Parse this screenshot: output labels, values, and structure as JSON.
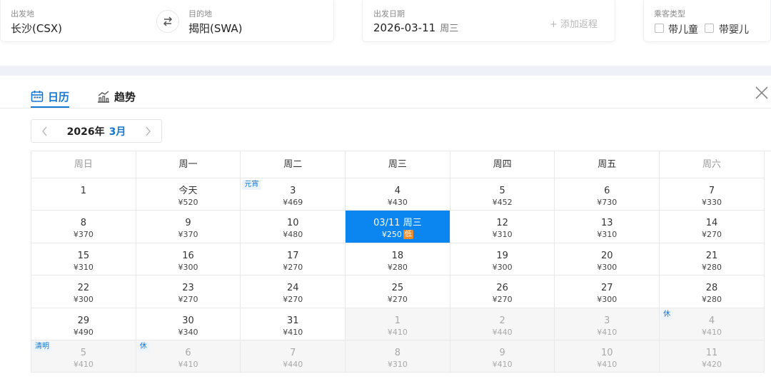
{
  "search": {
    "origin": {
      "label": "出发地",
      "value": "长沙(CSX)"
    },
    "destination": {
      "label": "目的地",
      "value": "揭阳(SWA)"
    },
    "depart": {
      "label": "出发日期",
      "date": "2026-03-11",
      "weekday": "周三"
    },
    "add_return": "+ 添加返程",
    "passengers": {
      "label": "乘客类型",
      "child": "带儿童",
      "infant": "带婴儿"
    }
  },
  "tabs": {
    "calendar": "日历",
    "trend": "趋势"
  },
  "month_nav": {
    "year": "2026年",
    "month": "3月"
  },
  "weekdays": [
    "周日",
    "周一",
    "周二",
    "周三",
    "周四",
    "周五",
    "周六"
  ],
  "weeks": [
    [
      {
        "day": "1",
        "price": ""
      },
      {
        "day": "今天",
        "price": "¥520"
      },
      {
        "day": "3",
        "price": "¥469",
        "tag": "元宵"
      },
      {
        "day": "4",
        "price": "¥430"
      },
      {
        "day": "5",
        "price": "¥452"
      },
      {
        "day": "6",
        "price": "¥730"
      },
      {
        "day": "7",
        "price": "¥330"
      }
    ],
    [
      {
        "day": "8",
        "price": "¥370"
      },
      {
        "day": "9",
        "price": "¥370"
      },
      {
        "day": "10",
        "price": "¥480"
      },
      {
        "day": "03/11 周三",
        "price": "¥250",
        "selected": true,
        "badge": "低"
      },
      {
        "day": "12",
        "price": "¥310"
      },
      {
        "day": "13",
        "price": "¥310"
      },
      {
        "day": "14",
        "price": "¥270"
      }
    ],
    [
      {
        "day": "15",
        "price": "¥310"
      },
      {
        "day": "16",
        "price": "¥300"
      },
      {
        "day": "17",
        "price": "¥270"
      },
      {
        "day": "18",
        "price": "¥280"
      },
      {
        "day": "19",
        "price": "¥300"
      },
      {
        "day": "20",
        "price": "¥300"
      },
      {
        "day": "21",
        "price": "¥280"
      }
    ],
    [
      {
        "day": "22",
        "price": "¥300"
      },
      {
        "day": "23",
        "price": "¥270"
      },
      {
        "day": "24",
        "price": "¥270"
      },
      {
        "day": "25",
        "price": "¥270"
      },
      {
        "day": "26",
        "price": "¥270"
      },
      {
        "day": "27",
        "price": "¥300"
      },
      {
        "day": "28",
        "price": "¥280"
      }
    ],
    [
      {
        "day": "29",
        "price": "¥490"
      },
      {
        "day": "30",
        "price": "¥340"
      },
      {
        "day": "31",
        "price": "¥410"
      },
      {
        "day": "1",
        "price": "¥410",
        "other": true
      },
      {
        "day": "2",
        "price": "¥440",
        "other": true
      },
      {
        "day": "3",
        "price": "¥410",
        "other": true
      },
      {
        "day": "4",
        "price": "¥410",
        "other": true,
        "tag": "休"
      }
    ],
    [
      {
        "day": "5",
        "price": "¥410",
        "other": true,
        "tag": "清明"
      },
      {
        "day": "6",
        "price": "¥410",
        "other": true,
        "tag": "休"
      },
      {
        "day": "7",
        "price": "¥440",
        "other": true
      },
      {
        "day": "8",
        "price": "¥310",
        "other": true
      },
      {
        "day": "9",
        "price": "¥410",
        "other": true
      },
      {
        "day": "10",
        "price": "¥410",
        "other": true
      },
      {
        "day": "11",
        "price": "¥420",
        "other": true
      }
    ]
  ],
  "colors": {
    "accent": "#1677d2",
    "selected": "#0b86f0",
    "low_badge": "#f08a24"
  }
}
